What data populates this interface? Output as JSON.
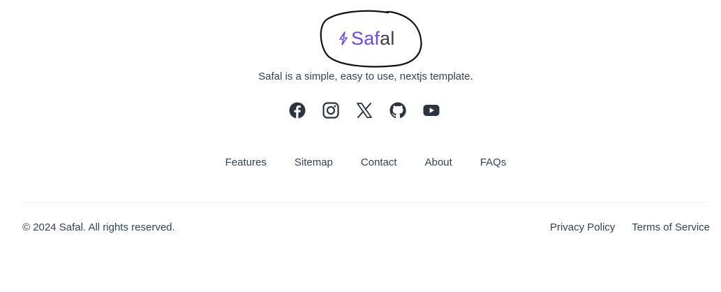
{
  "brand": {
    "name_main": "Saf",
    "name_tail": "al",
    "accent_color": "#6d4ae8",
    "annotation_color": "#111111",
    "icon": "lightning-bolt-icon"
  },
  "tagline": "Safal is a simple, easy to use, nextjs template.",
  "socials": [
    {
      "icon": "facebook-icon"
    },
    {
      "icon": "instagram-icon"
    },
    {
      "icon": "x-icon"
    },
    {
      "icon": "github-icon"
    },
    {
      "icon": "youtube-icon"
    }
  ],
  "nav": {
    "features": "Features",
    "sitemap": "Sitemap",
    "contact": "Contact",
    "about": "About",
    "faqs": "FAQs"
  },
  "copyright": "© 2024 Safal. All rights reserved.",
  "legal": {
    "privacy": "Privacy Policy",
    "terms": "Terms of Service"
  }
}
